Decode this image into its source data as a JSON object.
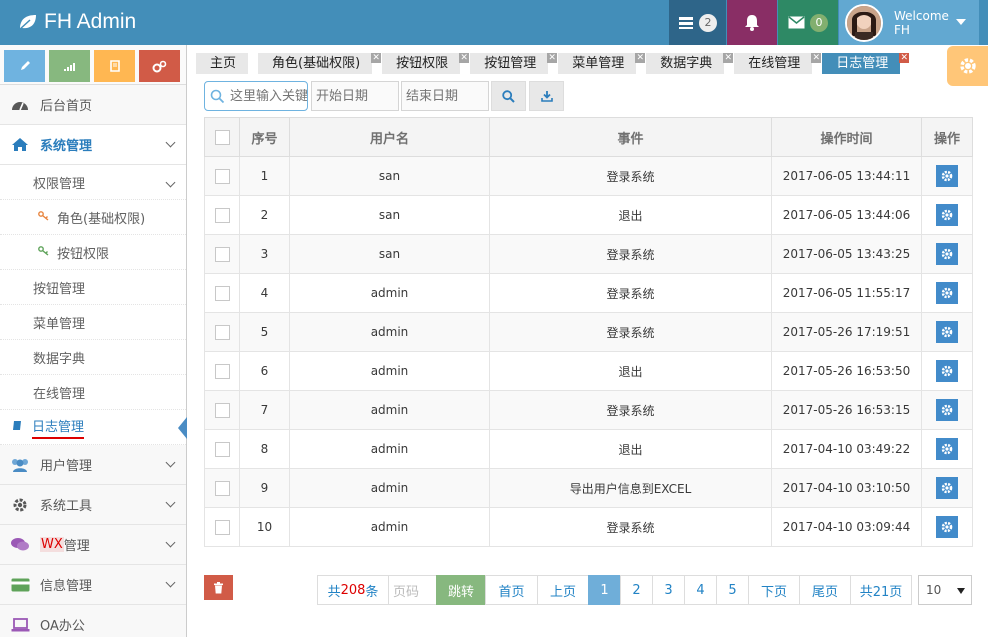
{
  "brand": {
    "title": "FH Admin"
  },
  "navbar": {
    "tasks_count": "2",
    "messages_count": "0",
    "welcome": "Welcome",
    "username": "FH"
  },
  "sidebar": {
    "items": [
      {
        "label": "后台首页",
        "icon": "dashboard-icon"
      },
      {
        "label": "系统管理",
        "icon": "home-icon"
      },
      {
        "label": "权限管理"
      },
      {
        "label": "角色(基础权限)",
        "icon": "key-icon"
      },
      {
        "label": "按钮权限",
        "icon": "key-icon"
      },
      {
        "label": "按钮管理"
      },
      {
        "label": "菜单管理"
      },
      {
        "label": "数据字典"
      },
      {
        "label": "在线管理"
      },
      {
        "label": "日志管理",
        "icon": "book-icon"
      },
      {
        "label": "用户管理",
        "icon": "users-icon"
      },
      {
        "label": "系统工具",
        "icon": "cog-icon"
      },
      {
        "label_prefix": "WX",
        "label": "管理",
        "icon": "comments-icon"
      },
      {
        "label": "信息管理",
        "icon": "credit-card-icon"
      },
      {
        "label": "OA办公",
        "icon": "laptop-icon"
      }
    ]
  },
  "tabs": [
    {
      "label": "主页"
    },
    {
      "label": "角色(基础权限)"
    },
    {
      "label": "按钮权限"
    },
    {
      "label": "按钮管理"
    },
    {
      "label": "菜单管理"
    },
    {
      "label": "数据字典"
    },
    {
      "label": "在线管理"
    },
    {
      "label": "日志管理"
    }
  ],
  "toolbar": {
    "search_placeholder": "这里输入关键词",
    "start_date_placeholder": "开始日期",
    "end_date_placeholder": "结束日期"
  },
  "table": {
    "headers": {
      "no": "序号",
      "user": "用户名",
      "event": "事件",
      "time": "操作时间",
      "op": "操作"
    },
    "rows": [
      {
        "no": "1",
        "user": "san",
        "event": "登录系统",
        "time": "2017-06-05 13:44:11"
      },
      {
        "no": "2",
        "user": "san",
        "event": "退出",
        "time": "2017-06-05 13:44:06"
      },
      {
        "no": "3",
        "user": "san",
        "event": "登录系统",
        "time": "2017-06-05 13:43:25"
      },
      {
        "no": "4",
        "user": "admin",
        "event": "登录系统",
        "time": "2017-06-05 11:55:17"
      },
      {
        "no": "5",
        "user": "admin",
        "event": "登录系统",
        "time": "2017-05-26 17:19:51"
      },
      {
        "no": "6",
        "user": "admin",
        "event": "退出",
        "time": "2017-05-26 16:53:50"
      },
      {
        "no": "7",
        "user": "admin",
        "event": "登录系统",
        "time": "2017-05-26 16:53:15"
      },
      {
        "no": "8",
        "user": "admin",
        "event": "退出",
        "time": "2017-04-10 03:49:22"
      },
      {
        "no": "9",
        "user": "admin",
        "event": "导出用户信息到EXCEL",
        "time": "2017-04-10 03:10:50"
      },
      {
        "no": "10",
        "user": "admin",
        "event": "登录系统",
        "time": "2017-04-10 03:09:44"
      }
    ]
  },
  "pager": {
    "total_prefix": "共",
    "total_count": "208",
    "total_suffix": "条",
    "page_input_placeholder": "页码",
    "jump": "跳转",
    "first": "首页",
    "prev": "上页",
    "pages": [
      "1",
      "2",
      "3",
      "4",
      "5"
    ],
    "current": "1",
    "next": "下页",
    "last": "尾页",
    "total_pages": "共21页",
    "page_size": "10"
  },
  "colors": {
    "navbar": "#438eb9",
    "accent": "#2b7dbc",
    "danger": "#d15b47",
    "success": "#87b87f",
    "warning": "#ffb752"
  }
}
